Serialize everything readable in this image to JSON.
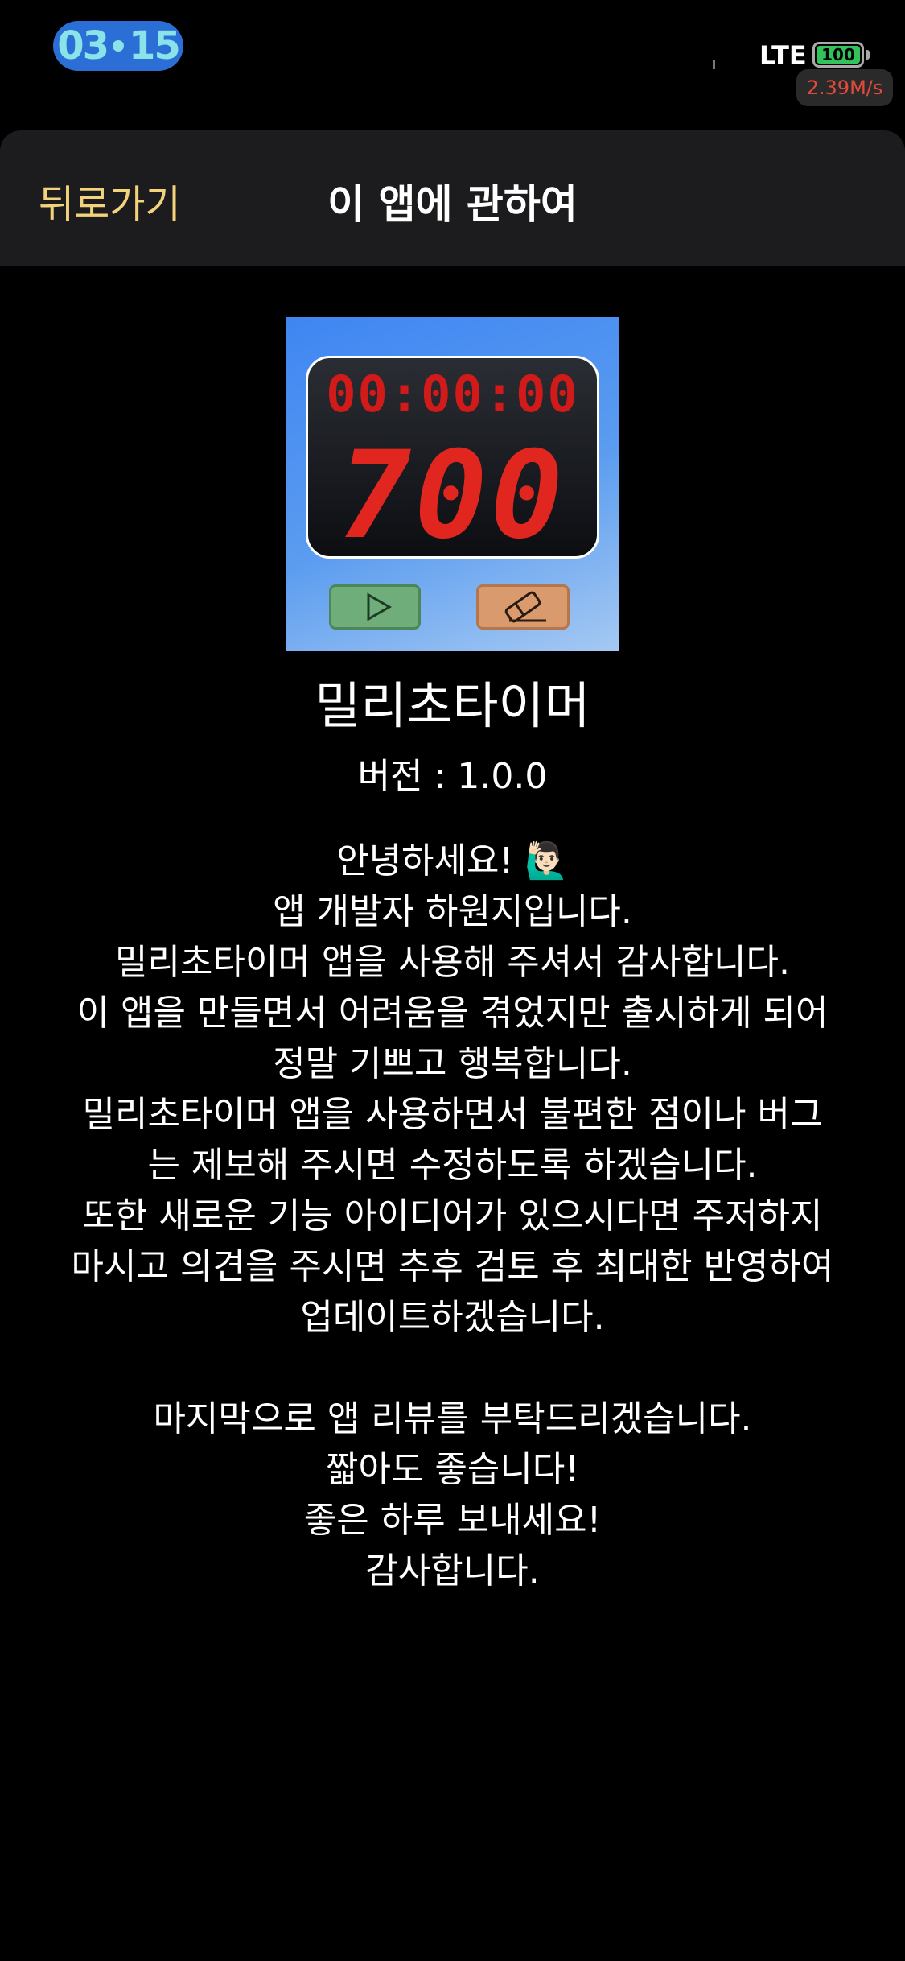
{
  "status_bar": {
    "time_hours": "03",
    "time_minutes": "15",
    "network": "LTE",
    "battery": "100",
    "net_speed": "2.39M/s"
  },
  "nav": {
    "back_label": "뒤로가기",
    "title": "이 앱에 관하여"
  },
  "app_icon": {
    "time_display": "00:00:00",
    "count_display": "700",
    "play_icon": "play-icon",
    "reset_icon": "eraser-icon"
  },
  "app": {
    "name": "밀리초타이머",
    "version": "버전 : 1.0.0"
  },
  "message": {
    "lines": [
      "안녕하세요! 🙋🏻‍♂️",
      "앱 개발자 하원지입니다.",
      "밀리초타이머 앱을 사용해 주셔서 감사합니다.",
      "이 앱을 만들면서 어려움을 겪었지만 출시하게 되어",
      "정말 기쁘고 행복합니다.",
      "밀리초타이머 앱을 사용하면서 불편한 점이나 버그",
      "는 제보해 주시면 수정하도록 하겠습니다.",
      "또한 새로운 기능 아이디어가 있으시다면 주저하지",
      "마시고 의견을 주시면 추후 검토 후 최대한 반영하여",
      "업데이트하겠습니다."
    ],
    "closing_lines": [
      "마지막으로 앱 리뷰를 부탁드리겠습니다.",
      "짧아도 좋습니다!",
      "좋은 하루 보내세요!",
      "감사합니다."
    ]
  },
  "colors": {
    "back_button": "#f2d27a",
    "nav_background": "#1c1c1e",
    "icon_background": "#4a8ff0",
    "segment_red": "#e0261e"
  }
}
